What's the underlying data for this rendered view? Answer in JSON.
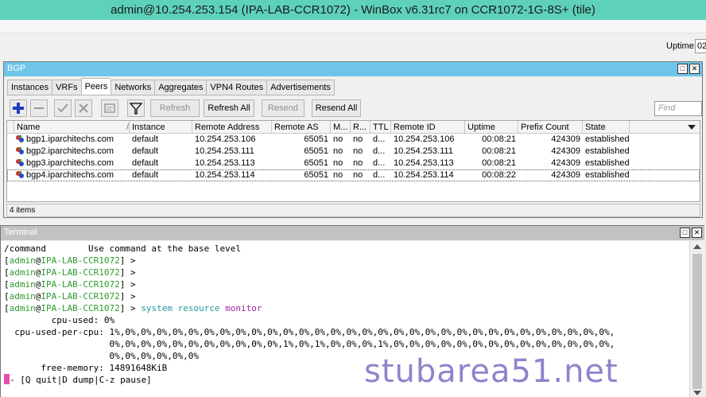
{
  "window_title": "admin@10.254.253.154 (IPA-LAB-CCR1072) - WinBox v6.31rc7 on CCR1072-1G-8S+ (tile)",
  "status": {
    "uptime_label": "Uptime:",
    "uptime_value": "02"
  },
  "bgp": {
    "title": "BGP",
    "tabs": [
      "Instances",
      "VRFs",
      "Peers",
      "Networks",
      "Aggregates",
      "VPN4 Routes",
      "Advertisements"
    ],
    "active_tab": "Peers",
    "toolbar": {
      "add_icon": "plus-icon",
      "remove_icon": "minus-icon",
      "enable_icon": "check-icon",
      "disable_icon": "cross-icon",
      "comment_icon": "comment-icon",
      "filter_icon": "filter-icon",
      "refresh": "Refresh",
      "refresh_all": "Refresh All",
      "resend": "Resend",
      "resend_all": "Resend All",
      "find_placeholder": "Find"
    },
    "columns": [
      "Name",
      "Instance",
      "Remote Address",
      "Remote AS",
      "M...",
      "R...",
      "TTL",
      "Remote ID",
      "Uptime",
      "Prefix Count",
      "State"
    ],
    "rows": [
      [
        "bgp1.iparchitechs.com",
        "default",
        "10.254.253.106",
        "65051",
        "no",
        "no",
        "d...",
        "10.254.253.106",
        "00:08:21",
        "424309",
        "established"
      ],
      [
        "bgp2.iparchitechs.com",
        "default",
        "10.254.253.111",
        "65051",
        "no",
        "no",
        "d...",
        "10.254.253.111",
        "00:08:21",
        "424309",
        "established"
      ],
      [
        "bgp3.iparchitechs.com",
        "default",
        "10.254.253.113",
        "65051",
        "no",
        "no",
        "d...",
        "10.254.253.113",
        "00:08:21",
        "424309",
        "established"
      ],
      [
        "bgp4.iparchitechs.com",
        "default",
        "10.254.253.114",
        "65051",
        "no",
        "no",
        "d...",
        "10.254.253.114",
        "00:08:22",
        "424309",
        "established"
      ]
    ],
    "item_count": "4 items"
  },
  "terminal": {
    "title": "Terminal",
    "line0": "/command        Use command at the base level",
    "prompt_open": "[",
    "prompt_user": "admin",
    "prompt_at": "@",
    "prompt_host": "IPA-LAB-CCR1072",
    "prompt_close": "] > ",
    "cmd_path": "system resource ",
    "cmd_name": "monitor",
    "line_cpu_used": "         cpu-used: 0%",
    "line_cpu_per_1": "  cpu-used-per-cpu: 1%,0%,0%,0%,0%,0%,0%,0%,0%,0%,0%,0%,0%,0%,0%,0%,0%,0%,0%,0%,0%,0%,0%,0%,0%,0%,0%,0%,0%,0%,0%,0%,",
    "line_cpu_per_2": "                    0%,0%,0%,0%,0%,0%,0%,0%,0%,0%,0%,1%,0%,1%,0%,0%,0%,1%,0%,0%,0%,0%,0%,0%,0%,0%,0%,0%,0%,0%,0%,0%,",
    "line_cpu_per_3": "                    0%,0%,0%,0%,0%,0%",
    "line_free_mem": "       free-memory: 14891648KiB",
    "footer": "- [Q quit|D dump|C-z pause]"
  },
  "watermark": "stubarea51.net"
}
